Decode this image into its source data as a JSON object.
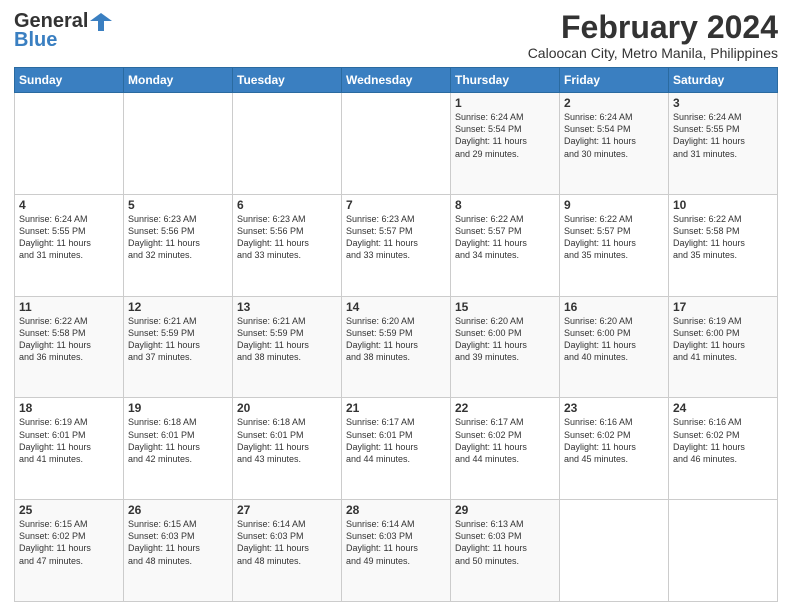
{
  "header": {
    "logo_line1": "General",
    "logo_line2": "Blue",
    "main_title": "February 2024",
    "subtitle": "Caloocan City, Metro Manila, Philippines"
  },
  "calendar": {
    "days_of_week": [
      "Sunday",
      "Monday",
      "Tuesday",
      "Wednesday",
      "Thursday",
      "Friday",
      "Saturday"
    ],
    "weeks": [
      [
        {
          "day": "",
          "info": ""
        },
        {
          "day": "",
          "info": ""
        },
        {
          "day": "",
          "info": ""
        },
        {
          "day": "",
          "info": ""
        },
        {
          "day": "1",
          "info": "Sunrise: 6:24 AM\nSunset: 5:54 PM\nDaylight: 11 hours\nand 29 minutes."
        },
        {
          "day": "2",
          "info": "Sunrise: 6:24 AM\nSunset: 5:54 PM\nDaylight: 11 hours\nand 30 minutes."
        },
        {
          "day": "3",
          "info": "Sunrise: 6:24 AM\nSunset: 5:55 PM\nDaylight: 11 hours\nand 31 minutes."
        }
      ],
      [
        {
          "day": "4",
          "info": "Sunrise: 6:24 AM\nSunset: 5:55 PM\nDaylight: 11 hours\nand 31 minutes."
        },
        {
          "day": "5",
          "info": "Sunrise: 6:23 AM\nSunset: 5:56 PM\nDaylight: 11 hours\nand 32 minutes."
        },
        {
          "day": "6",
          "info": "Sunrise: 6:23 AM\nSunset: 5:56 PM\nDaylight: 11 hours\nand 33 minutes."
        },
        {
          "day": "7",
          "info": "Sunrise: 6:23 AM\nSunset: 5:57 PM\nDaylight: 11 hours\nand 33 minutes."
        },
        {
          "day": "8",
          "info": "Sunrise: 6:22 AM\nSunset: 5:57 PM\nDaylight: 11 hours\nand 34 minutes."
        },
        {
          "day": "9",
          "info": "Sunrise: 6:22 AM\nSunset: 5:57 PM\nDaylight: 11 hours\nand 35 minutes."
        },
        {
          "day": "10",
          "info": "Sunrise: 6:22 AM\nSunset: 5:58 PM\nDaylight: 11 hours\nand 35 minutes."
        }
      ],
      [
        {
          "day": "11",
          "info": "Sunrise: 6:22 AM\nSunset: 5:58 PM\nDaylight: 11 hours\nand 36 minutes."
        },
        {
          "day": "12",
          "info": "Sunrise: 6:21 AM\nSunset: 5:59 PM\nDaylight: 11 hours\nand 37 minutes."
        },
        {
          "day": "13",
          "info": "Sunrise: 6:21 AM\nSunset: 5:59 PM\nDaylight: 11 hours\nand 38 minutes."
        },
        {
          "day": "14",
          "info": "Sunrise: 6:20 AM\nSunset: 5:59 PM\nDaylight: 11 hours\nand 38 minutes."
        },
        {
          "day": "15",
          "info": "Sunrise: 6:20 AM\nSunset: 6:00 PM\nDaylight: 11 hours\nand 39 minutes."
        },
        {
          "day": "16",
          "info": "Sunrise: 6:20 AM\nSunset: 6:00 PM\nDaylight: 11 hours\nand 40 minutes."
        },
        {
          "day": "17",
          "info": "Sunrise: 6:19 AM\nSunset: 6:00 PM\nDaylight: 11 hours\nand 41 minutes."
        }
      ],
      [
        {
          "day": "18",
          "info": "Sunrise: 6:19 AM\nSunset: 6:01 PM\nDaylight: 11 hours\nand 41 minutes."
        },
        {
          "day": "19",
          "info": "Sunrise: 6:18 AM\nSunset: 6:01 PM\nDaylight: 11 hours\nand 42 minutes."
        },
        {
          "day": "20",
          "info": "Sunrise: 6:18 AM\nSunset: 6:01 PM\nDaylight: 11 hours\nand 43 minutes."
        },
        {
          "day": "21",
          "info": "Sunrise: 6:17 AM\nSunset: 6:01 PM\nDaylight: 11 hours\nand 44 minutes."
        },
        {
          "day": "22",
          "info": "Sunrise: 6:17 AM\nSunset: 6:02 PM\nDaylight: 11 hours\nand 44 minutes."
        },
        {
          "day": "23",
          "info": "Sunrise: 6:16 AM\nSunset: 6:02 PM\nDaylight: 11 hours\nand 45 minutes."
        },
        {
          "day": "24",
          "info": "Sunrise: 6:16 AM\nSunset: 6:02 PM\nDaylight: 11 hours\nand 46 minutes."
        }
      ],
      [
        {
          "day": "25",
          "info": "Sunrise: 6:15 AM\nSunset: 6:02 PM\nDaylight: 11 hours\nand 47 minutes."
        },
        {
          "day": "26",
          "info": "Sunrise: 6:15 AM\nSunset: 6:03 PM\nDaylight: 11 hours\nand 48 minutes."
        },
        {
          "day": "27",
          "info": "Sunrise: 6:14 AM\nSunset: 6:03 PM\nDaylight: 11 hours\nand 48 minutes."
        },
        {
          "day": "28",
          "info": "Sunrise: 6:14 AM\nSunset: 6:03 PM\nDaylight: 11 hours\nand 49 minutes."
        },
        {
          "day": "29",
          "info": "Sunrise: 6:13 AM\nSunset: 6:03 PM\nDaylight: 11 hours\nand 50 minutes."
        },
        {
          "day": "",
          "info": ""
        },
        {
          "day": "",
          "info": ""
        }
      ]
    ]
  }
}
